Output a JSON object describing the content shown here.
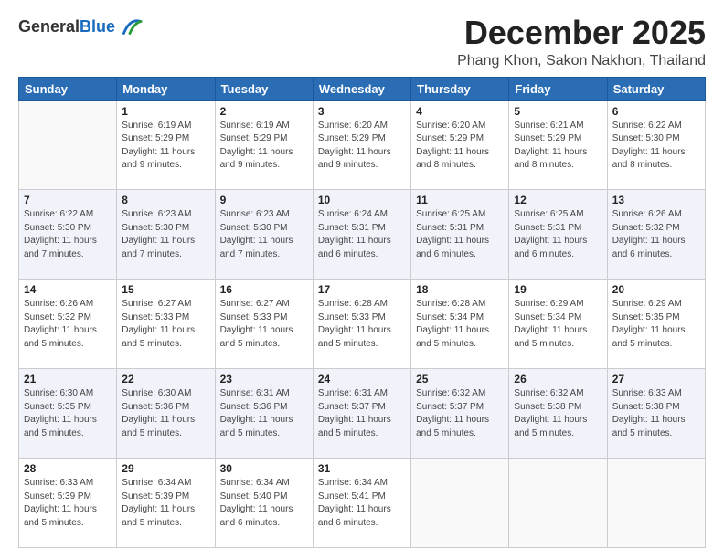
{
  "header": {
    "logo_line1": "General",
    "logo_line2": "Blue",
    "month": "December 2025",
    "location": "Phang Khon, Sakon Nakhon, Thailand"
  },
  "weekdays": [
    "Sunday",
    "Monday",
    "Tuesday",
    "Wednesday",
    "Thursday",
    "Friday",
    "Saturday"
  ],
  "weeks": [
    [
      {
        "day": "",
        "info": ""
      },
      {
        "day": "1",
        "info": "Sunrise: 6:19 AM\nSunset: 5:29 PM\nDaylight: 11 hours\nand 9 minutes."
      },
      {
        "day": "2",
        "info": "Sunrise: 6:19 AM\nSunset: 5:29 PM\nDaylight: 11 hours\nand 9 minutes."
      },
      {
        "day": "3",
        "info": "Sunrise: 6:20 AM\nSunset: 5:29 PM\nDaylight: 11 hours\nand 9 minutes."
      },
      {
        "day": "4",
        "info": "Sunrise: 6:20 AM\nSunset: 5:29 PM\nDaylight: 11 hours\nand 8 minutes."
      },
      {
        "day": "5",
        "info": "Sunrise: 6:21 AM\nSunset: 5:29 PM\nDaylight: 11 hours\nand 8 minutes."
      },
      {
        "day": "6",
        "info": "Sunrise: 6:22 AM\nSunset: 5:30 PM\nDaylight: 11 hours\nand 8 minutes."
      }
    ],
    [
      {
        "day": "7",
        "info": "Sunrise: 6:22 AM\nSunset: 5:30 PM\nDaylight: 11 hours\nand 7 minutes."
      },
      {
        "day": "8",
        "info": "Sunrise: 6:23 AM\nSunset: 5:30 PM\nDaylight: 11 hours\nand 7 minutes."
      },
      {
        "day": "9",
        "info": "Sunrise: 6:23 AM\nSunset: 5:30 PM\nDaylight: 11 hours\nand 7 minutes."
      },
      {
        "day": "10",
        "info": "Sunrise: 6:24 AM\nSunset: 5:31 PM\nDaylight: 11 hours\nand 6 minutes."
      },
      {
        "day": "11",
        "info": "Sunrise: 6:25 AM\nSunset: 5:31 PM\nDaylight: 11 hours\nand 6 minutes."
      },
      {
        "day": "12",
        "info": "Sunrise: 6:25 AM\nSunset: 5:31 PM\nDaylight: 11 hours\nand 6 minutes."
      },
      {
        "day": "13",
        "info": "Sunrise: 6:26 AM\nSunset: 5:32 PM\nDaylight: 11 hours\nand 6 minutes."
      }
    ],
    [
      {
        "day": "14",
        "info": "Sunrise: 6:26 AM\nSunset: 5:32 PM\nDaylight: 11 hours\nand 5 minutes."
      },
      {
        "day": "15",
        "info": "Sunrise: 6:27 AM\nSunset: 5:33 PM\nDaylight: 11 hours\nand 5 minutes."
      },
      {
        "day": "16",
        "info": "Sunrise: 6:27 AM\nSunset: 5:33 PM\nDaylight: 11 hours\nand 5 minutes."
      },
      {
        "day": "17",
        "info": "Sunrise: 6:28 AM\nSunset: 5:33 PM\nDaylight: 11 hours\nand 5 minutes."
      },
      {
        "day": "18",
        "info": "Sunrise: 6:28 AM\nSunset: 5:34 PM\nDaylight: 11 hours\nand 5 minutes."
      },
      {
        "day": "19",
        "info": "Sunrise: 6:29 AM\nSunset: 5:34 PM\nDaylight: 11 hours\nand 5 minutes."
      },
      {
        "day": "20",
        "info": "Sunrise: 6:29 AM\nSunset: 5:35 PM\nDaylight: 11 hours\nand 5 minutes."
      }
    ],
    [
      {
        "day": "21",
        "info": "Sunrise: 6:30 AM\nSunset: 5:35 PM\nDaylight: 11 hours\nand 5 minutes."
      },
      {
        "day": "22",
        "info": "Sunrise: 6:30 AM\nSunset: 5:36 PM\nDaylight: 11 hours\nand 5 minutes."
      },
      {
        "day": "23",
        "info": "Sunrise: 6:31 AM\nSunset: 5:36 PM\nDaylight: 11 hours\nand 5 minutes."
      },
      {
        "day": "24",
        "info": "Sunrise: 6:31 AM\nSunset: 5:37 PM\nDaylight: 11 hours\nand 5 minutes."
      },
      {
        "day": "25",
        "info": "Sunrise: 6:32 AM\nSunset: 5:37 PM\nDaylight: 11 hours\nand 5 minutes."
      },
      {
        "day": "26",
        "info": "Sunrise: 6:32 AM\nSunset: 5:38 PM\nDaylight: 11 hours\nand 5 minutes."
      },
      {
        "day": "27",
        "info": "Sunrise: 6:33 AM\nSunset: 5:38 PM\nDaylight: 11 hours\nand 5 minutes."
      }
    ],
    [
      {
        "day": "28",
        "info": "Sunrise: 6:33 AM\nSunset: 5:39 PM\nDaylight: 11 hours\nand 5 minutes."
      },
      {
        "day": "29",
        "info": "Sunrise: 6:34 AM\nSunset: 5:39 PM\nDaylight: 11 hours\nand 5 minutes."
      },
      {
        "day": "30",
        "info": "Sunrise: 6:34 AM\nSunset: 5:40 PM\nDaylight: 11 hours\nand 6 minutes."
      },
      {
        "day": "31",
        "info": "Sunrise: 6:34 AM\nSunset: 5:41 PM\nDaylight: 11 hours\nand 6 minutes."
      },
      {
        "day": "",
        "info": ""
      },
      {
        "day": "",
        "info": ""
      },
      {
        "day": "",
        "info": ""
      }
    ]
  ]
}
